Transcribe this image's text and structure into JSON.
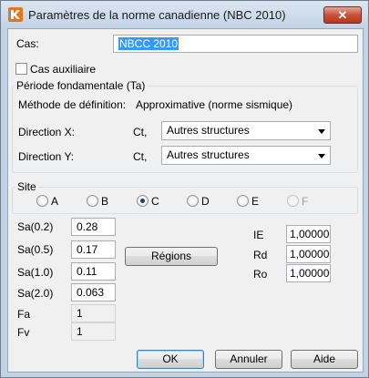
{
  "window": {
    "title": "Paramètres de la norme canadienne (NBC 2010)",
    "close_glyph": "✕",
    "app_icon": "app-logo-icon"
  },
  "cas": {
    "label": "Cas:",
    "value": "NBCC 2010"
  },
  "cas_auxiliaire": {
    "label": "Cas auxiliaire",
    "checked": false
  },
  "periode": {
    "title": "Période fondamentale (Ta)",
    "methode_label": "Méthode de définition:",
    "methode_value": "Approximative (norme sismique)",
    "direction_x_label": "Direction X:",
    "direction_y_label": "Direction Y:",
    "ct_label": "Ct,",
    "direction_x_value": "Autres structures",
    "direction_y_value": "Autres structures"
  },
  "site": {
    "title": "Site",
    "options": [
      {
        "label": "A",
        "checked": false,
        "enabled": true
      },
      {
        "label": "B",
        "checked": false,
        "enabled": true
      },
      {
        "label": "C",
        "checked": true,
        "enabled": true
      },
      {
        "label": "D",
        "checked": false,
        "enabled": true
      },
      {
        "label": "E",
        "checked": false,
        "enabled": true
      },
      {
        "label": "F",
        "checked": false,
        "enabled": false
      }
    ]
  },
  "params": {
    "sa02_label": "Sa(0.2)",
    "sa02_value": "0.28",
    "sa05_label": "Sa(0.5)",
    "sa05_value": "0.17",
    "sa10_label": "Sa(1.0)",
    "sa10_value": "0.11",
    "sa20_label": "Sa(2.0)",
    "sa20_value": "0.063",
    "fa_label": "Fa",
    "fa_value": "1",
    "fv_label": "Fv",
    "fv_value": "1"
  },
  "regions_button": "Régions",
  "factors": {
    "ie_label": "IE",
    "ie_value": "1,000000",
    "rd_label": "Rd",
    "rd_value": "1,000000",
    "ro_label": "Ro",
    "ro_value": "1,000000"
  },
  "buttons": {
    "ok": "OK",
    "annuler": "Annuler",
    "aide": "Aide"
  }
}
